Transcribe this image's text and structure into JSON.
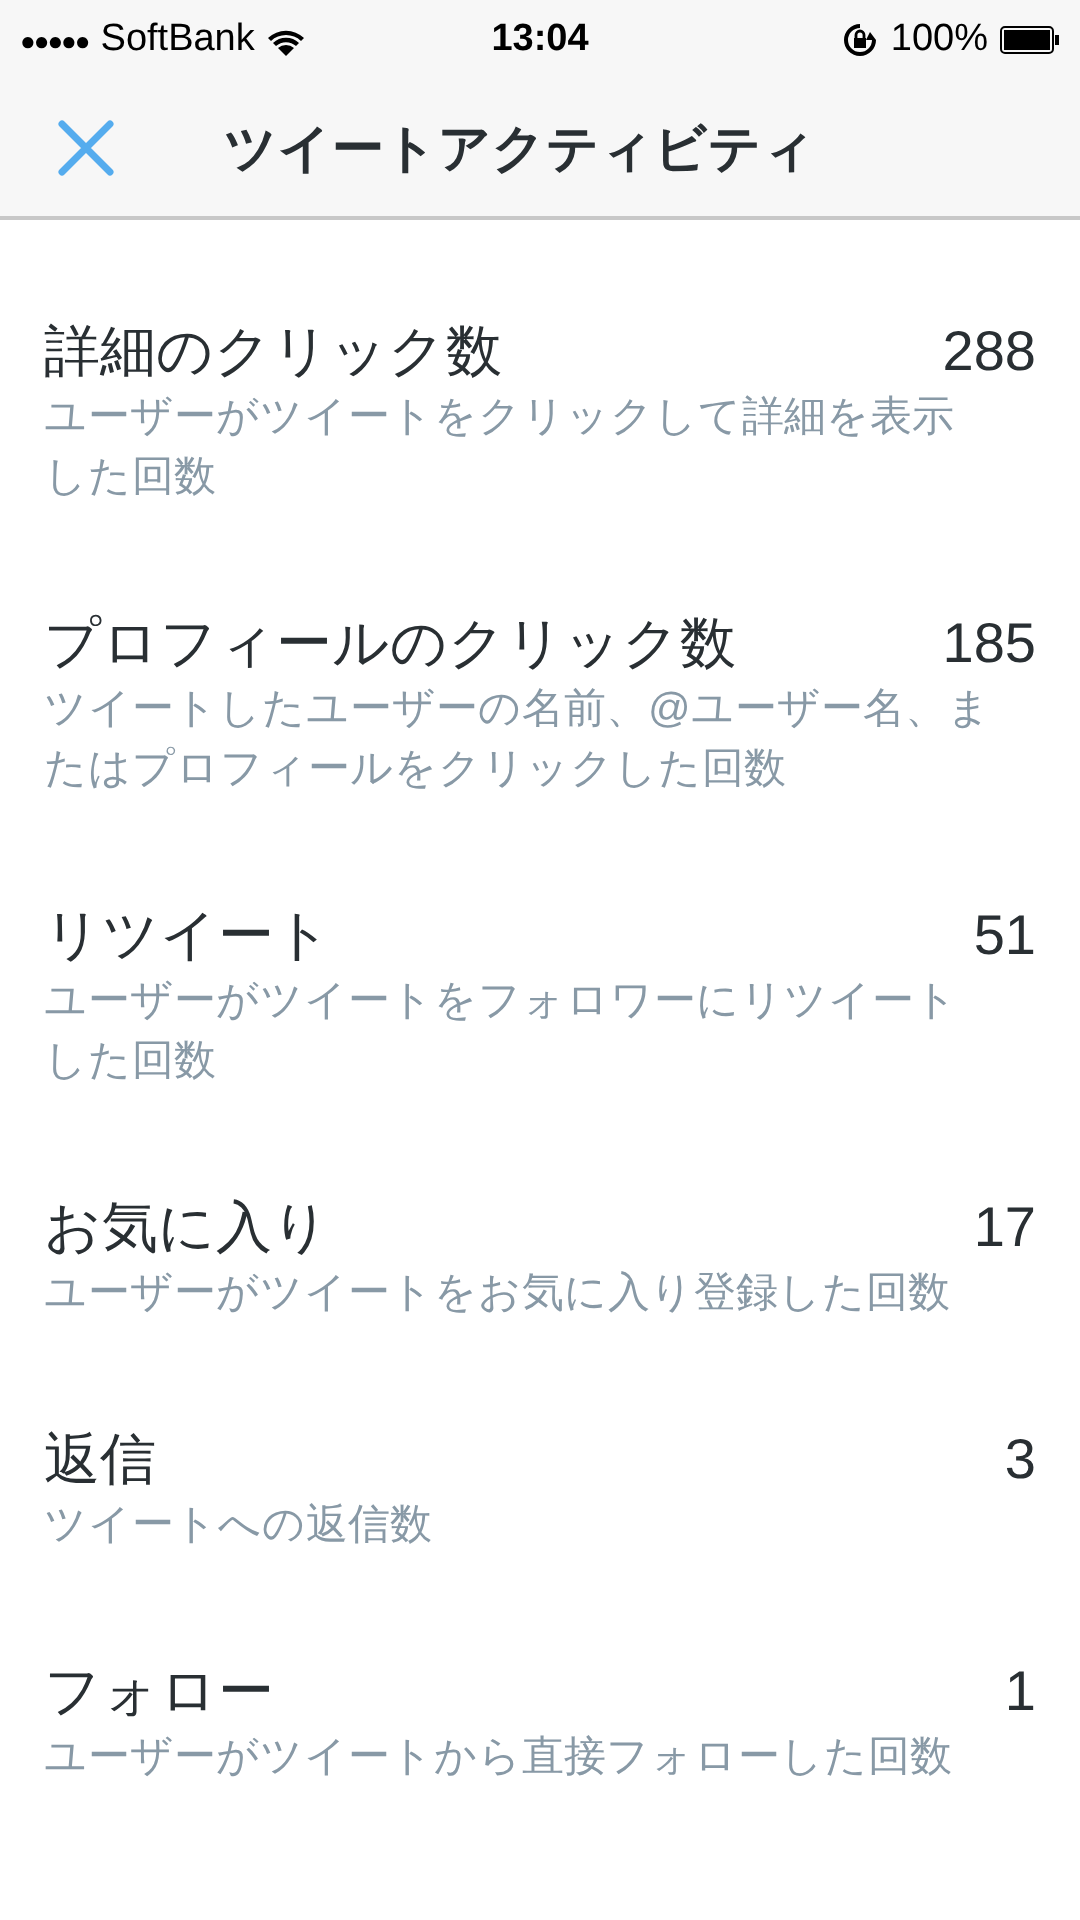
{
  "status_bar": {
    "signal": "●●●●●",
    "carrier": "SoftBank",
    "time": "13:04",
    "battery": "100%"
  },
  "header": {
    "title": "ツイートアクティビティ"
  },
  "metrics": [
    {
      "label": "詳細のクリック数",
      "value": "288",
      "description": "ユーザーがツイートをクリックして詳細を表示した回数"
    },
    {
      "label": "プロフィールのクリック数",
      "value": "185",
      "description": "ツイートしたユーザーの名前、@ユーザー名、またはプロフィールをクリックした回数"
    },
    {
      "label": "リツイート",
      "value": "51",
      "description": "ユーザーがツイートをフォロワーにリツイートした回数"
    },
    {
      "label": "お気に入り",
      "value": "17",
      "description": "ユーザーがツイートをお気に入り登録した回数"
    },
    {
      "label": "返信",
      "value": "3",
      "description": "ツイートへの返信数"
    },
    {
      "label": "フォロー",
      "value": "1",
      "description": "ユーザーがツイートから直接フォローした回数"
    }
  ]
}
